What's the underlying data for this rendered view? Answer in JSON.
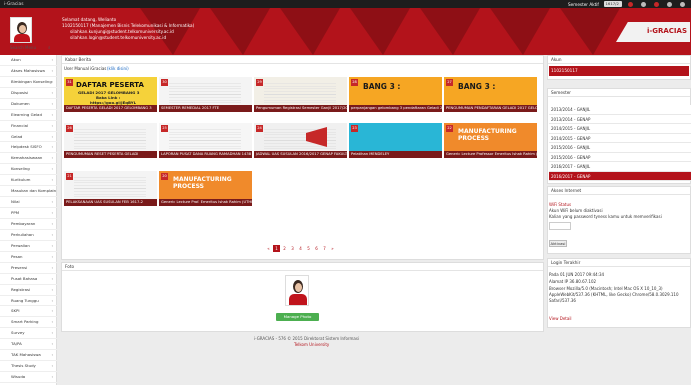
{
  "topbar": {
    "brand": "i-Gracias",
    "semester_label": "Semester Aktif",
    "semester_value": "1617/2",
    "badge": "3"
  },
  "user": {
    "greeting": "Selamat datang, Welianto",
    "id_line": "1102150117 (Manajemen Bisnis Telekomunikasi & Informatika)",
    "email1": "silahkan.kunjungi@student.telkomuniversity.ac.id",
    "email2": "silahkan.login@student.telkomuniversity.ac.id"
  },
  "brand_logo": "i-GRACIAS",
  "sidebar": {
    "search": "Search Menu",
    "items": [
      "Akun",
      "Akses Mahasiswa",
      "Bimbingan Konseling",
      "Disposisi",
      "Dokumen",
      "Elearning Gelad",
      "Financial",
      "Gelad",
      "Helpdesk SISFO",
      "Kemahasiswaan",
      "Konseling",
      "Kurikulum",
      "Masukan dan Komplain",
      "Nilai",
      "PPM",
      "Pembayaran",
      "Perkuliahan",
      "Perwalian",
      "Pesan",
      "Presensi",
      "Pusat Bahasa",
      "Registrasi",
      "Ruang Tunggu",
      "SKPI",
      "Smart Parking",
      "Survey",
      "TA/PA",
      "TAK Mahasiswa",
      "Thesis Study",
      "Wisuda"
    ]
  },
  "news": {
    "title": "Kabar Berita",
    "manual_label": "User Manual iGracias",
    "manual_link": "(klik disini)",
    "tiles": [
      {
        "num": "31",
        "cap": "DAFTAR PESERTA GELADI 2017 GELOMBANG 3",
        "headline": "DAFTAR PESERTA",
        "sub1": "GELADI 2017 GELOMBANG 3",
        "sub2": "Baka Link :",
        "sub3": "https://goo.gl/JEqBYL",
        "style": "yellow"
      },
      {
        "num": "30",
        "cap": "SEMESTER REMEDIAL 2017 FTE",
        "style": "doc"
      },
      {
        "num": "29",
        "cap": "Pengumuman Registrasi Semester Ganjil 2017/2018",
        "style": "doc2"
      },
      {
        "num": "28",
        "cap": "perpanjangan gelombang 3 pendaftaran Geladi 2017",
        "headline": "BANG 3 :",
        "style": "orange"
      },
      {
        "num": "27",
        "cap": "PENGUMUMAN PENDAFTARAN GELADI 2017 GELOMBANG 3",
        "headline": "BANG 3 :",
        "style": "orange"
      },
      {
        "num": "26",
        "cap": "PENGUMUMAN RESET PESERTA GELADI",
        "style": "doc"
      },
      {
        "num": "25",
        "cap": "LAPORAN PUSAT DANA RUANG RAMADHAN 1438 H",
        "style": "doc3"
      },
      {
        "num": "24",
        "cap": "JADWAL UAS SUSULAN 2016/2017 GENAP FAKULTAS INDUSTRI KREATIF",
        "style": "mega"
      },
      {
        "num": "23",
        "cap": "Pelatihan MENDELEY",
        "style": "cyan"
      },
      {
        "num": "22",
        "cap": "Generic Lecture Professor Emeritus Ishak Rahim (UTHM Malaysia)",
        "headline": "MANUFACTURING PROCESS",
        "style": "mfg"
      },
      {
        "num": "21",
        "cap": "PELAKSANAAN UAS SUSULAN FEB 1617-2",
        "style": "doc"
      },
      {
        "num": "20",
        "cap": "Generic Lecture Prof. Emeritus Ishak Rahim (UTHM Malaysia)",
        "headline": "MANUFACTURING PROCESS",
        "style": "mfg"
      }
    ],
    "pages": [
      "«",
      "1",
      "2",
      "3",
      "4",
      "5",
      "6",
      "7",
      "»"
    ],
    "active_page": "1"
  },
  "foto": {
    "title": "Foto",
    "button": "Manage Photo"
  },
  "footer": {
    "line1": "i-GRACIAS - 576 © 2015 Direktorat Sistem Informasi",
    "line2": "Telkom University"
  },
  "akun": {
    "title": "Akun",
    "value": "1102150117"
  },
  "semester": {
    "title": "Semester",
    "items": [
      "2013/2014 - GANJIL",
      "2013/2014 - GENAP",
      "2014/2015 - GANJIL",
      "2014/2015 - GENAP",
      "2015/2016 - GANJIL",
      "2015/2016 - GENAP",
      "2016/2017 - GANJIL",
      "2016/2017 - GENAP"
    ],
    "active": "2016/2017 - GENAP"
  },
  "wifi": {
    "title": "Akses Internet",
    "status_title": "WiFi Status",
    "line1": "Akun WiFi belum diaktivasi",
    "line2": "Kalian yang password tyness kamu untuk memverifikasi",
    "button": "Aktivasi"
  },
  "login": {
    "title": "Login Terakhir",
    "line1": "Pada 01 JUN 2017 09:44:34",
    "line2": "Alamat IP 36.80.67.102",
    "line3": "Browser Mozilla/5.0 (Macintosh; Intel Mac OS X 10_10_3)",
    "line4": "AppleWebKit/537.36 (KHTML, like Gecko) Chrome/58.0.3029.110",
    "line5": "Safari/537.36",
    "detail_link": "View Detail"
  },
  "colors": {
    "primary": "#b3131b",
    "dark": "#1d1d1d",
    "button_green": "#4caf50"
  }
}
